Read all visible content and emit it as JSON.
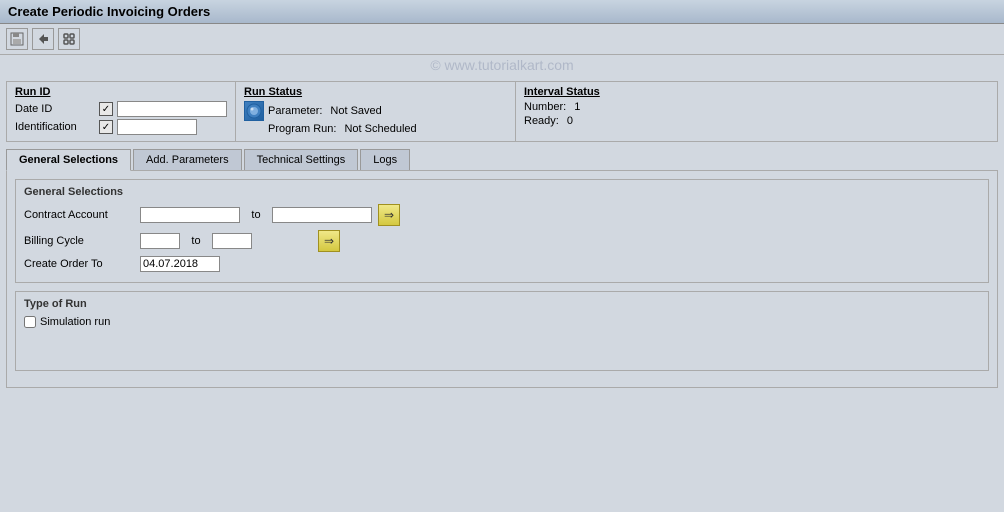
{
  "titleBar": {
    "title": "Create Periodic Invoicing Orders"
  },
  "toolbar": {
    "buttons": [
      "save",
      "back",
      "command"
    ]
  },
  "watermark": "© www.tutorialkart.com",
  "runId": {
    "label": "Run ID",
    "dateIdLabel": "Date ID",
    "identificationLabel": "Identification"
  },
  "runStatus": {
    "label": "Run Status",
    "statusIcon": "●",
    "parameterLabel": "Parameter:",
    "parameterValue": "Not Saved",
    "programRunLabel": "Program Run:",
    "programRunValue": "Not Scheduled"
  },
  "intervalStatus": {
    "label": "Interval Status",
    "numberLabel": "Number:",
    "numberValue": "1",
    "readyLabel": "Ready:",
    "readyValue": "0"
  },
  "tabs": [
    {
      "id": "general",
      "label": "General Selections",
      "active": true
    },
    {
      "id": "add",
      "label": "Add. Parameters",
      "active": false
    },
    {
      "id": "technical",
      "label": "Technical Settings",
      "active": false
    },
    {
      "id": "logs",
      "label": "Logs",
      "active": false
    }
  ],
  "generalSelections": {
    "sectionTitle": "General Selections",
    "contractAccountLabel": "Contract Account",
    "contractAccountFrom": "",
    "contractAccountTo": "",
    "toLabel1": "to",
    "billingCycleLabel": "Billing Cycle",
    "billingCycleFrom": "",
    "billingCycleTo": "",
    "toLabel2": "to",
    "createOrderToLabel": "Create Order To",
    "createOrderToValue": "04.07.2018"
  },
  "typeOfRun": {
    "sectionTitle": "Type of Run",
    "simulationRunLabel": "Simulation run",
    "simulationRunChecked": false
  }
}
